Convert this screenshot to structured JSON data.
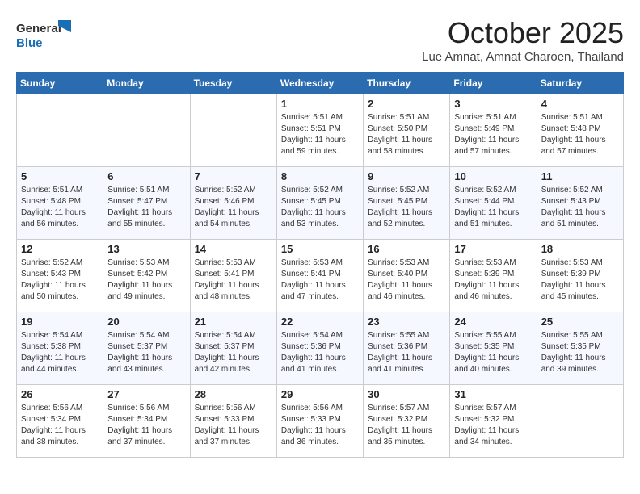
{
  "header": {
    "logo_line1": "General",
    "logo_line2": "Blue",
    "month": "October 2025",
    "location": "Lue Amnat, Amnat Charoen, Thailand"
  },
  "days_of_week": [
    "Sunday",
    "Monday",
    "Tuesday",
    "Wednesday",
    "Thursday",
    "Friday",
    "Saturday"
  ],
  "weeks": [
    [
      {
        "day": "",
        "info": ""
      },
      {
        "day": "",
        "info": ""
      },
      {
        "day": "",
        "info": ""
      },
      {
        "day": "1",
        "info": "Sunrise: 5:51 AM\nSunset: 5:51 PM\nDaylight: 11 hours\nand 59 minutes."
      },
      {
        "day": "2",
        "info": "Sunrise: 5:51 AM\nSunset: 5:50 PM\nDaylight: 11 hours\nand 58 minutes."
      },
      {
        "day": "3",
        "info": "Sunrise: 5:51 AM\nSunset: 5:49 PM\nDaylight: 11 hours\nand 57 minutes."
      },
      {
        "day": "4",
        "info": "Sunrise: 5:51 AM\nSunset: 5:48 PM\nDaylight: 11 hours\nand 57 minutes."
      }
    ],
    [
      {
        "day": "5",
        "info": "Sunrise: 5:51 AM\nSunset: 5:48 PM\nDaylight: 11 hours\nand 56 minutes."
      },
      {
        "day": "6",
        "info": "Sunrise: 5:51 AM\nSunset: 5:47 PM\nDaylight: 11 hours\nand 55 minutes."
      },
      {
        "day": "7",
        "info": "Sunrise: 5:52 AM\nSunset: 5:46 PM\nDaylight: 11 hours\nand 54 minutes."
      },
      {
        "day": "8",
        "info": "Sunrise: 5:52 AM\nSunset: 5:45 PM\nDaylight: 11 hours\nand 53 minutes."
      },
      {
        "day": "9",
        "info": "Sunrise: 5:52 AM\nSunset: 5:45 PM\nDaylight: 11 hours\nand 52 minutes."
      },
      {
        "day": "10",
        "info": "Sunrise: 5:52 AM\nSunset: 5:44 PM\nDaylight: 11 hours\nand 51 minutes."
      },
      {
        "day": "11",
        "info": "Sunrise: 5:52 AM\nSunset: 5:43 PM\nDaylight: 11 hours\nand 51 minutes."
      }
    ],
    [
      {
        "day": "12",
        "info": "Sunrise: 5:52 AM\nSunset: 5:43 PM\nDaylight: 11 hours\nand 50 minutes."
      },
      {
        "day": "13",
        "info": "Sunrise: 5:53 AM\nSunset: 5:42 PM\nDaylight: 11 hours\nand 49 minutes."
      },
      {
        "day": "14",
        "info": "Sunrise: 5:53 AM\nSunset: 5:41 PM\nDaylight: 11 hours\nand 48 minutes."
      },
      {
        "day": "15",
        "info": "Sunrise: 5:53 AM\nSunset: 5:41 PM\nDaylight: 11 hours\nand 47 minutes."
      },
      {
        "day": "16",
        "info": "Sunrise: 5:53 AM\nSunset: 5:40 PM\nDaylight: 11 hours\nand 46 minutes."
      },
      {
        "day": "17",
        "info": "Sunrise: 5:53 AM\nSunset: 5:39 PM\nDaylight: 11 hours\nand 46 minutes."
      },
      {
        "day": "18",
        "info": "Sunrise: 5:53 AM\nSunset: 5:39 PM\nDaylight: 11 hours\nand 45 minutes."
      }
    ],
    [
      {
        "day": "19",
        "info": "Sunrise: 5:54 AM\nSunset: 5:38 PM\nDaylight: 11 hours\nand 44 minutes."
      },
      {
        "day": "20",
        "info": "Sunrise: 5:54 AM\nSunset: 5:37 PM\nDaylight: 11 hours\nand 43 minutes."
      },
      {
        "day": "21",
        "info": "Sunrise: 5:54 AM\nSunset: 5:37 PM\nDaylight: 11 hours\nand 42 minutes."
      },
      {
        "day": "22",
        "info": "Sunrise: 5:54 AM\nSunset: 5:36 PM\nDaylight: 11 hours\nand 41 minutes."
      },
      {
        "day": "23",
        "info": "Sunrise: 5:55 AM\nSunset: 5:36 PM\nDaylight: 11 hours\nand 41 minutes."
      },
      {
        "day": "24",
        "info": "Sunrise: 5:55 AM\nSunset: 5:35 PM\nDaylight: 11 hours\nand 40 minutes."
      },
      {
        "day": "25",
        "info": "Sunrise: 5:55 AM\nSunset: 5:35 PM\nDaylight: 11 hours\nand 39 minutes."
      }
    ],
    [
      {
        "day": "26",
        "info": "Sunrise: 5:56 AM\nSunset: 5:34 PM\nDaylight: 11 hours\nand 38 minutes."
      },
      {
        "day": "27",
        "info": "Sunrise: 5:56 AM\nSunset: 5:34 PM\nDaylight: 11 hours\nand 37 minutes."
      },
      {
        "day": "28",
        "info": "Sunrise: 5:56 AM\nSunset: 5:33 PM\nDaylight: 11 hours\nand 37 minutes."
      },
      {
        "day": "29",
        "info": "Sunrise: 5:56 AM\nSunset: 5:33 PM\nDaylight: 11 hours\nand 36 minutes."
      },
      {
        "day": "30",
        "info": "Sunrise: 5:57 AM\nSunset: 5:32 PM\nDaylight: 11 hours\nand 35 minutes."
      },
      {
        "day": "31",
        "info": "Sunrise: 5:57 AM\nSunset: 5:32 PM\nDaylight: 11 hours\nand 34 minutes."
      },
      {
        "day": "",
        "info": ""
      }
    ]
  ]
}
